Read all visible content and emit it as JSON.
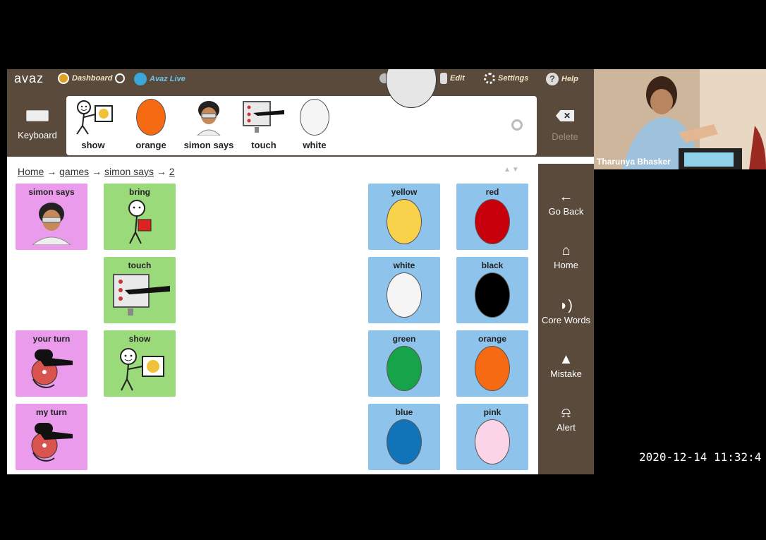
{
  "app": {
    "logo": "avaz",
    "topbar": {
      "dashboard": "Dashboard",
      "live": "Avaz Live",
      "edit": "Edit",
      "settings": "Settings",
      "help": "Help"
    },
    "keyboard_label": "Keyboard",
    "delete_label": "Delete",
    "sentence": [
      {
        "label": "show",
        "icon": "show-symbol-icon"
      },
      {
        "label": "orange",
        "icon": "orange-oval-icon"
      },
      {
        "label": "simon says",
        "icon": "simon-face-icon"
      },
      {
        "label": "touch",
        "icon": "touch-screen-icon"
      },
      {
        "label": "white",
        "icon": "white-oval-icon"
      }
    ],
    "breadcrumb": [
      "Home",
      "games",
      "simon says",
      "2"
    ],
    "tiles": {
      "simon_says": "simon says",
      "bring": "bring",
      "touch": "touch",
      "your_turn": "your turn",
      "show": "show",
      "my_turn": "my turn",
      "yellow": "yellow",
      "red": "red",
      "white": "white",
      "black": "black",
      "green": "green",
      "orange": "orange",
      "blue": "blue",
      "pink": "pink"
    },
    "colors": {
      "yellow": "#f8d24a",
      "red": "#c8000c",
      "white": "#f5f5f5",
      "black": "#000000",
      "green": "#17a34a",
      "orange": "#f56a12",
      "blue": "#1173b8",
      "pink": "#fcd4e8",
      "brand_brown": "#5a4a3c"
    },
    "nav": [
      "Go Back",
      "Home",
      "Core Words",
      "Mistake",
      "Alert"
    ]
  },
  "video": {
    "participant": "Tharunya Bhasker"
  },
  "timestamp": "2020-12-14 11:32:4"
}
